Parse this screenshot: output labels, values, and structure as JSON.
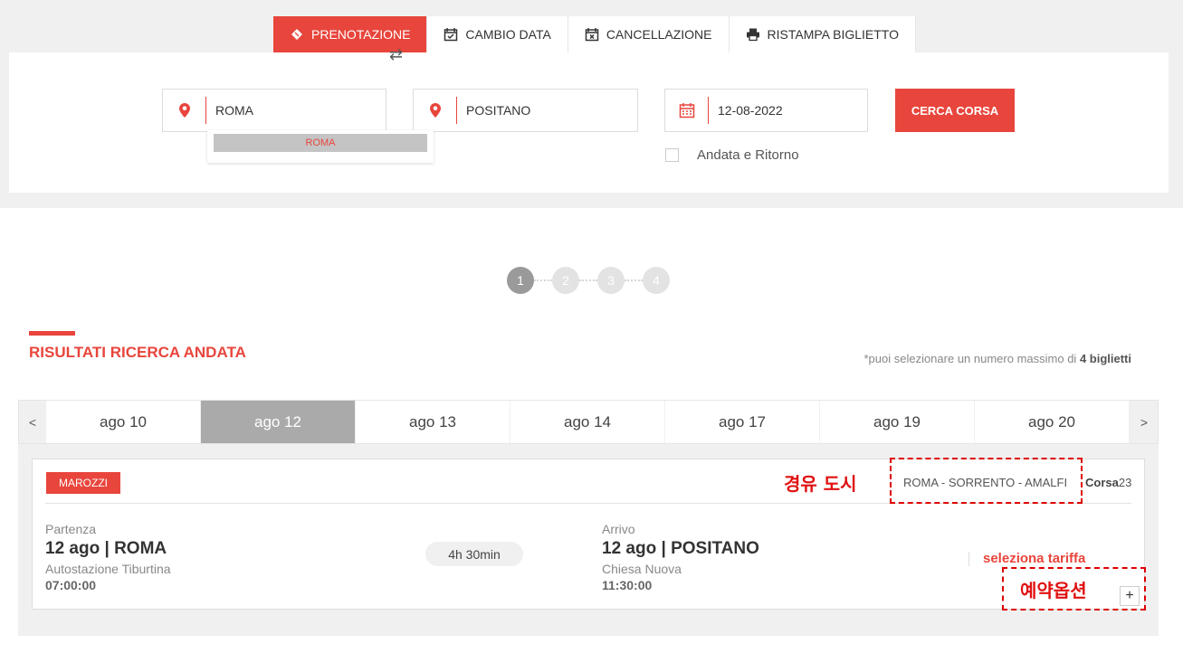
{
  "tabs": [
    {
      "label": "PRENOTAZIONE",
      "icon": "ticket-icon",
      "active": true
    },
    {
      "label": "CAMBIO DATA",
      "icon": "calendar-check-icon",
      "active": false
    },
    {
      "label": "CANCELLAZIONE",
      "icon": "calendar-x-icon",
      "active": false
    },
    {
      "label": "RISTAMPA BIGLIETTO",
      "icon": "printer-icon",
      "active": false
    }
  ],
  "search": {
    "from_value": "ROMA",
    "to_value": "POSITANO",
    "date_value": "12-08-2022",
    "autocomplete_item": "ROMA",
    "search_button": "CERCA CORSA",
    "roundtrip_label": "Andata e Ritorno",
    "swap_symbol": "⇄"
  },
  "steps": [
    "1",
    "2",
    "3",
    "4"
  ],
  "results": {
    "title": "RISULTATI RICERCA ANDATA",
    "note_prefix": "*puoi selezionare un numero massimo di ",
    "note_bold": "4 biglietti"
  },
  "date_nav": {
    "prev": "<",
    "next": ">",
    "dates": [
      "ago 10",
      "ago 12",
      "ago 13",
      "ago 14",
      "ago 17",
      "ago 19",
      "ago 20"
    ],
    "active_index": 1
  },
  "trip": {
    "operator": "MAROZZI",
    "route": "ROMA - SORRENTO - AMALFI",
    "corsa_label": "Corsa",
    "corsa_number": "23",
    "departure_label": "Partenza",
    "departure_main": "12 ago | ROMA",
    "departure_station": "Autostazione Tiburtina",
    "departure_time": "07:00:00",
    "duration": "4h 30min",
    "arrival_label": "Arrivo",
    "arrival_main": "12 ago | POSITANO",
    "arrival_station": "Chiesa Nuova",
    "arrival_time": "11:30:00",
    "select_fare": "seleziona tariffa",
    "expand": "+"
  },
  "annotations": {
    "via_cities": "경유 도시",
    "booking_options": "예약옵션"
  },
  "colors": {
    "accent": "#e8453c",
    "annotation": "#e01010"
  }
}
